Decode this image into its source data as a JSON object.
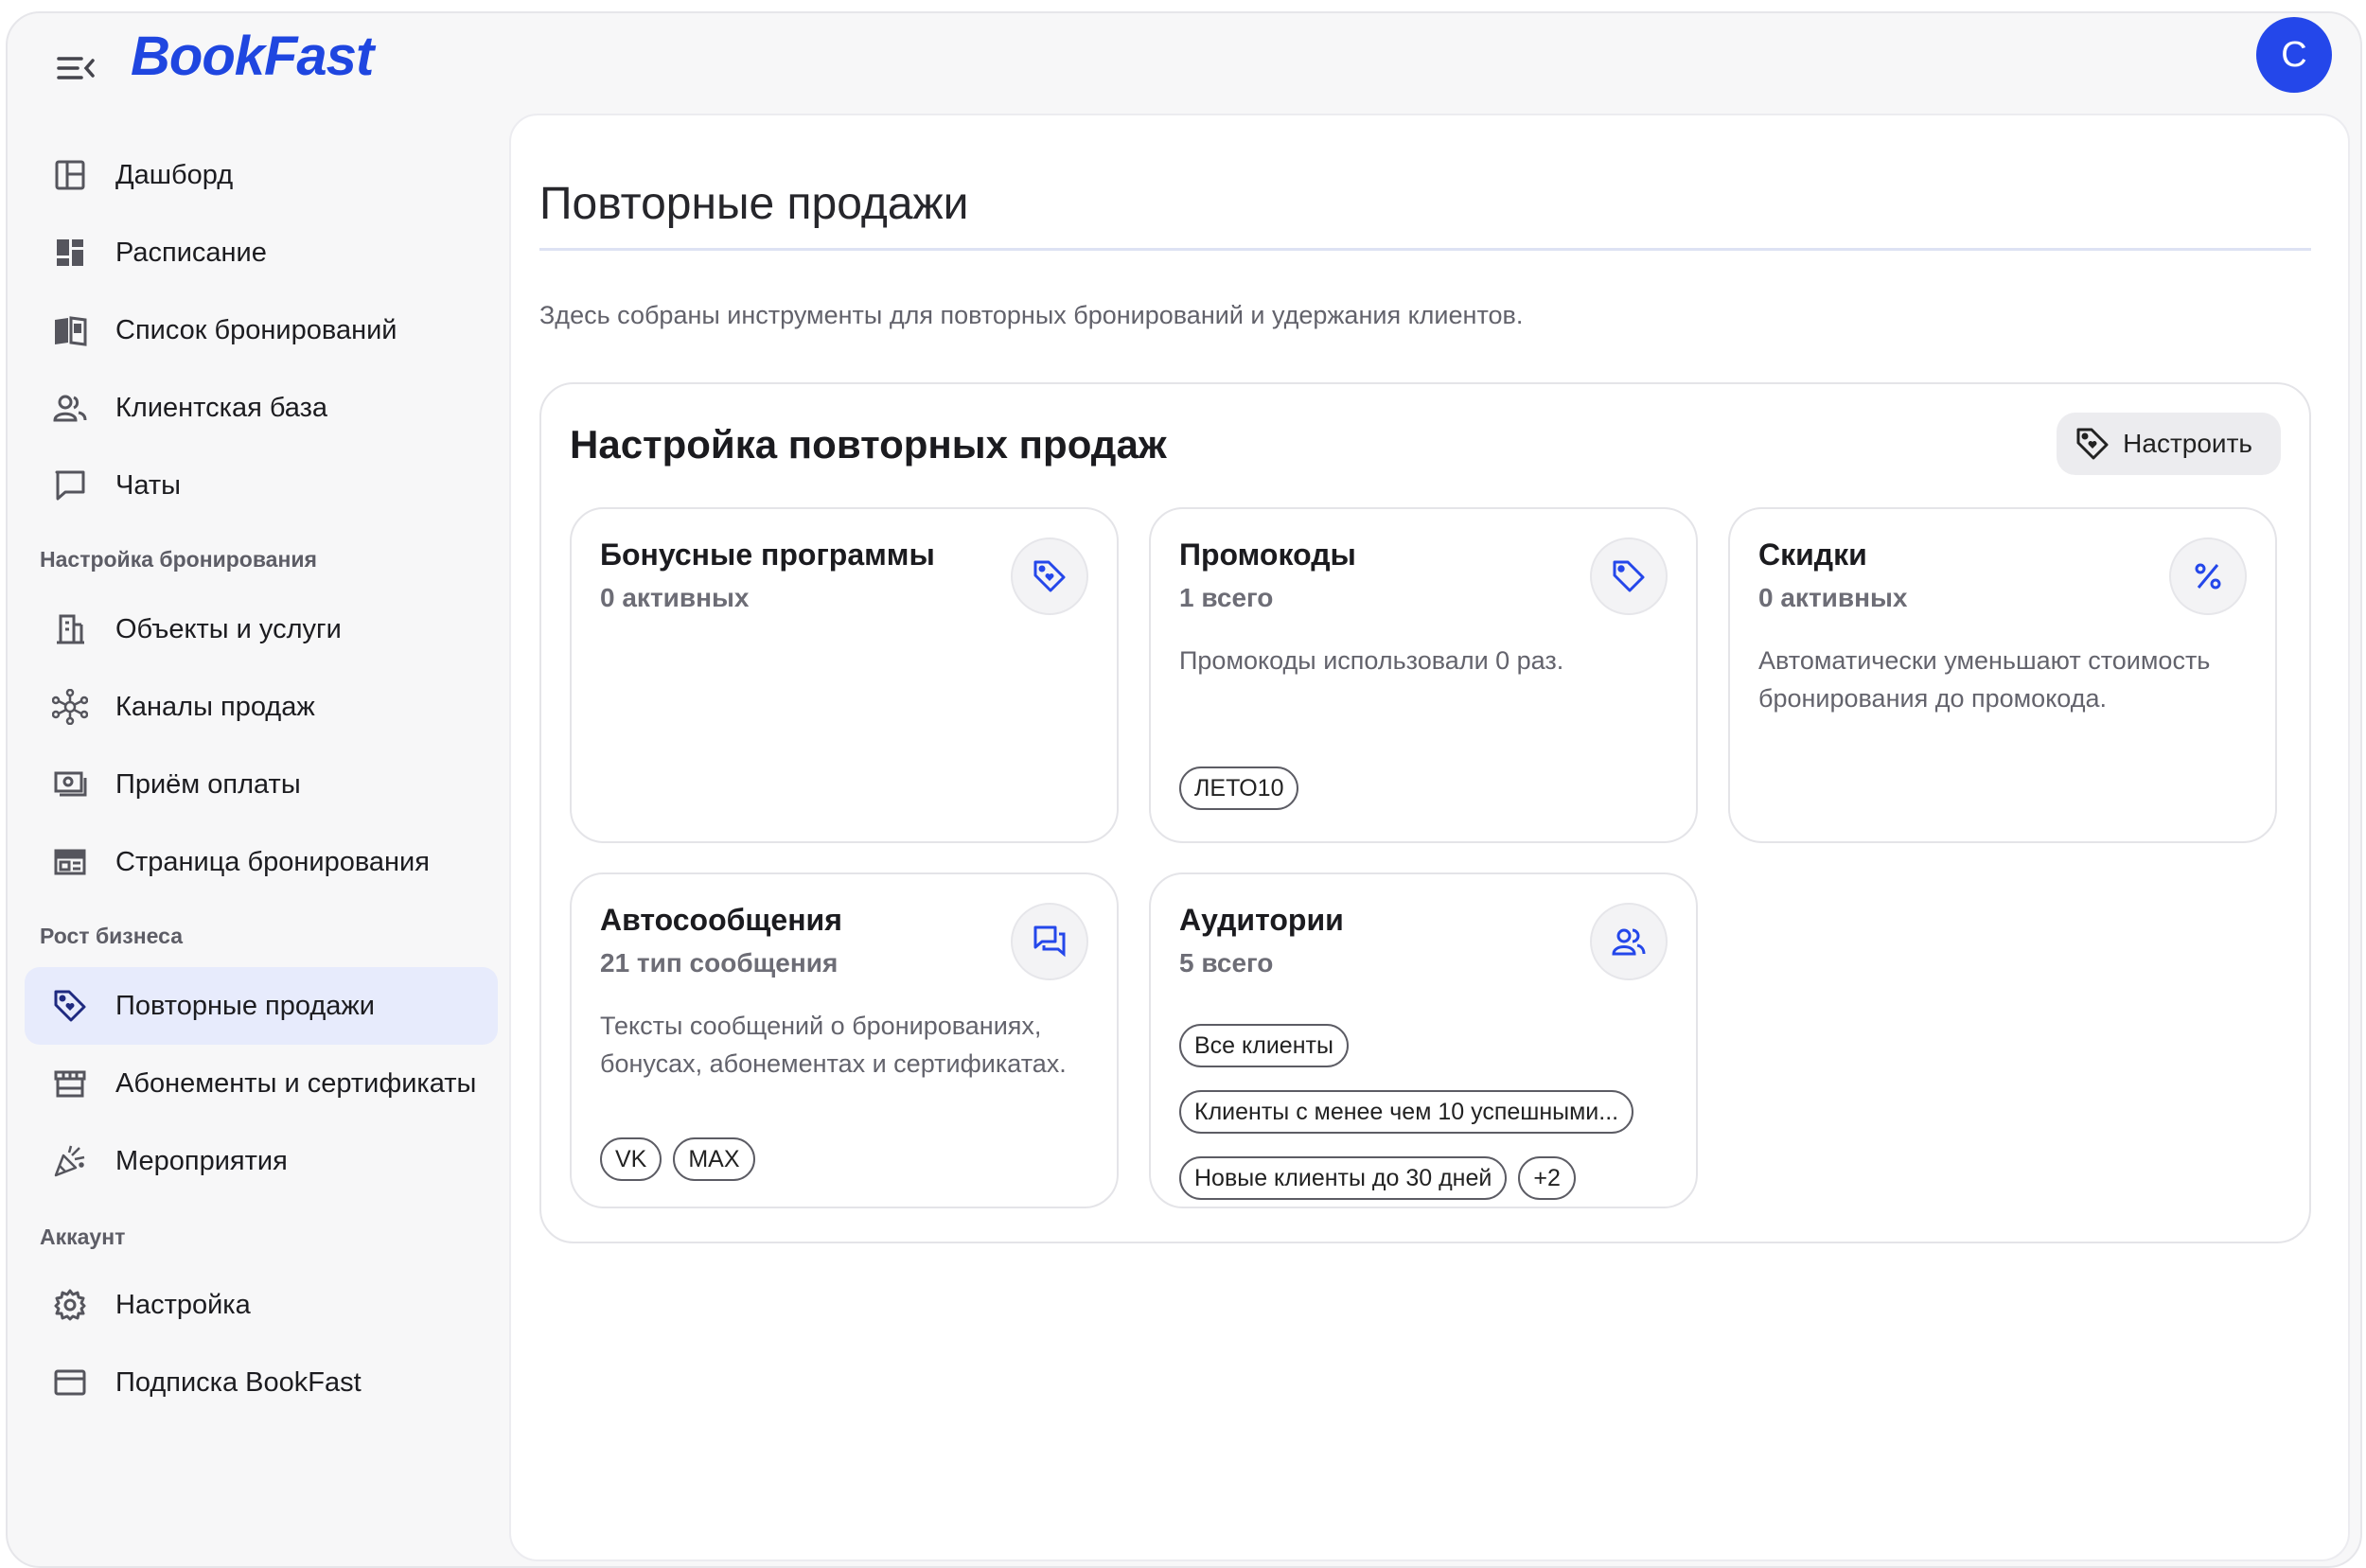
{
  "app": {
    "logo": "BookFast",
    "avatar_initial": "C"
  },
  "colors": {
    "accent": "#1f46e0",
    "active_bg": "#e7ebfc",
    "avatar_bg": "#2447ea"
  },
  "sidebar": {
    "items": [
      {
        "label": "Дашборд",
        "icon": "dashboard-icon"
      },
      {
        "label": "Расписание",
        "icon": "schedule-icon"
      },
      {
        "label": "Список бронирований",
        "icon": "bookings-list-icon"
      },
      {
        "label": "Клиентская база",
        "icon": "clients-icon"
      },
      {
        "label": "Чаты",
        "icon": "chat-icon"
      }
    ],
    "section_booking": "Настройка бронирования",
    "booking_items": [
      {
        "label": "Объекты и услуги",
        "icon": "building-icon"
      },
      {
        "label": "Каналы продаж",
        "icon": "network-icon"
      },
      {
        "label": "Приём оплаты",
        "icon": "payment-icon"
      },
      {
        "label": "Страница бронирования",
        "icon": "page-icon"
      }
    ],
    "section_growth": "Рост бизнеса",
    "growth_items": [
      {
        "label": "Повторные продажи",
        "icon": "tag-heart-icon",
        "active": true
      },
      {
        "label": "Абонементы и сертификаты",
        "icon": "store-icon"
      },
      {
        "label": "Мероприятия",
        "icon": "party-icon"
      }
    ],
    "section_account": "Аккаунт",
    "account_items": [
      {
        "label": "Настройка",
        "icon": "gear-icon"
      },
      {
        "label": "Подписка BookFast",
        "icon": "card-icon"
      }
    ]
  },
  "main": {
    "title": "Повторные продажи",
    "description": "Здесь собраны инструменты для повторных бронирований и удержания клиентов.",
    "panel": {
      "title": "Настройка повторных продаж",
      "config_button": "Настроить",
      "cards": [
        {
          "title": "Бонусные программы",
          "subtitle": "0 активных",
          "icon": "tag-heart-icon"
        },
        {
          "title": "Промокоды",
          "subtitle": "1 всего",
          "description": "Промокоды использовали 0 раз.",
          "chips": [
            "ЛЕТО10"
          ],
          "icon": "tag-icon"
        },
        {
          "title": "Скидки",
          "subtitle": "0 активных",
          "description": "Автоматически уменьшают стоимость бронирования до промокода.",
          "icon": "percent-icon"
        },
        {
          "title": "Автосообщения",
          "subtitle": "21 тип сообщения",
          "description": "Тексты сообщений о бронированиях, бонусах, абонементах и сертификатах.",
          "chips": [
            "VK",
            "MAX"
          ],
          "icon": "messages-icon"
        },
        {
          "title": "Аудитории",
          "subtitle": "5 всего",
          "chips": [
            "Все клиенты",
            "Клиенты с менее чем 10 успешными...",
            "Новые клиенты до 30 дней",
            "+2"
          ],
          "icon": "users-icon"
        }
      ]
    }
  }
}
